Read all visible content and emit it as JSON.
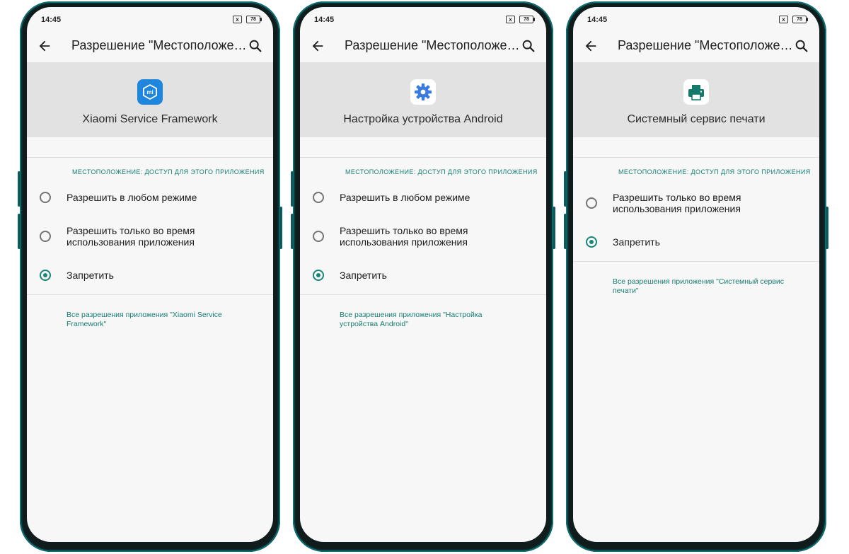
{
  "colors": {
    "accent": "#1a8576",
    "header_bg": "#e2e2e2",
    "frame": "#101b1c"
  },
  "phones": [
    {
      "status": {
        "time": "14:45",
        "sim_icon": "x",
        "battery": "78"
      },
      "appbar": {
        "title": "Разрешение \"Местоположение\"",
        "back_icon": "back-arrow-icon",
        "search_icon": "search-icon"
      },
      "app": {
        "name": "Xiaomi Service Framework",
        "icon": "xiaomi-mi-icon"
      },
      "section_label": "местоположение: доступ для этого приложения",
      "options": [
        {
          "label_1": "Разрешить в любом режиме",
          "label_2": "",
          "selected": false
        },
        {
          "label_1": "Разрешить только во время",
          "label_2": "использования приложения",
          "selected": false
        },
        {
          "label_1": "Запретить",
          "label_2": "",
          "selected": true
        }
      ],
      "footer_link": "Все разрешения приложения \"Xiaomi Service Framework\""
    },
    {
      "status": {
        "time": "14:45",
        "sim_icon": "x",
        "battery": "78"
      },
      "appbar": {
        "title": "Разрешение \"Местоположение\"",
        "back_icon": "back-arrow-icon",
        "search_icon": "search-icon"
      },
      "app": {
        "name": "Настройка устройства Android",
        "icon": "gear-icon"
      },
      "section_label": "местоположение: доступ для этого приложения",
      "options": [
        {
          "label_1": "Разрешить в любом режиме",
          "label_2": "",
          "selected": false
        },
        {
          "label_1": "Разрешить только во время",
          "label_2": "использования приложения",
          "selected": false
        },
        {
          "label_1": "Запретить",
          "label_2": "",
          "selected": true
        }
      ],
      "footer_link": "Все разрешения приложения \"Настройка устройства Android\""
    },
    {
      "status": {
        "time": "14:45",
        "sim_icon": "x",
        "battery": "78"
      },
      "appbar": {
        "title": "Разрешение \"Местоположение\"",
        "back_icon": "back-arrow-icon",
        "search_icon": "search-icon"
      },
      "app": {
        "name": "Системный сервис печати",
        "icon": "printer-icon"
      },
      "section_label": "местоположение: доступ для этого приложения",
      "options": [
        {
          "label_1": "Разрешить только во время",
          "label_2": "использования приложения",
          "selected": false
        },
        {
          "label_1": "Запретить",
          "label_2": "",
          "selected": true
        }
      ],
      "footer_link": "Все разрешения приложения \"Системный сервис печати\""
    }
  ]
}
